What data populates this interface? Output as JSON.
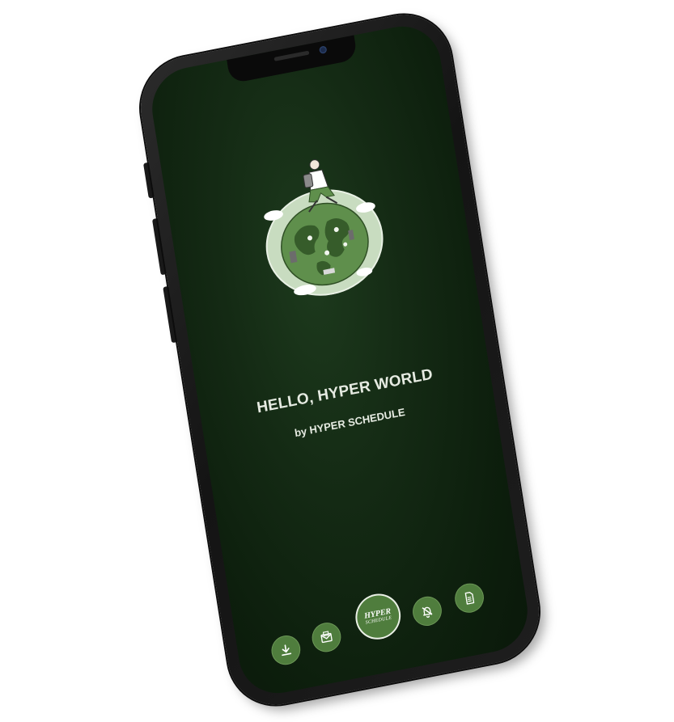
{
  "screen": {
    "title": "HELLO, HYPER WORLD",
    "subtitle": "by HYPER SCHEDULE"
  },
  "dock": {
    "items": [
      {
        "icon": "download-icon"
      },
      {
        "icon": "mail-icon"
      },
      {
        "icon": "hyper-schedule-logo",
        "logo_top": "HYPER",
        "logo_bottom": "SCHEDULE"
      },
      {
        "icon": "notifications-off-icon"
      },
      {
        "icon": "document-icon"
      }
    ]
  },
  "colors": {
    "screen_bg": "#142a14",
    "accent": "#4f7d3d",
    "globe_light": "#c8dcc0",
    "text": "#e6ebe2"
  }
}
